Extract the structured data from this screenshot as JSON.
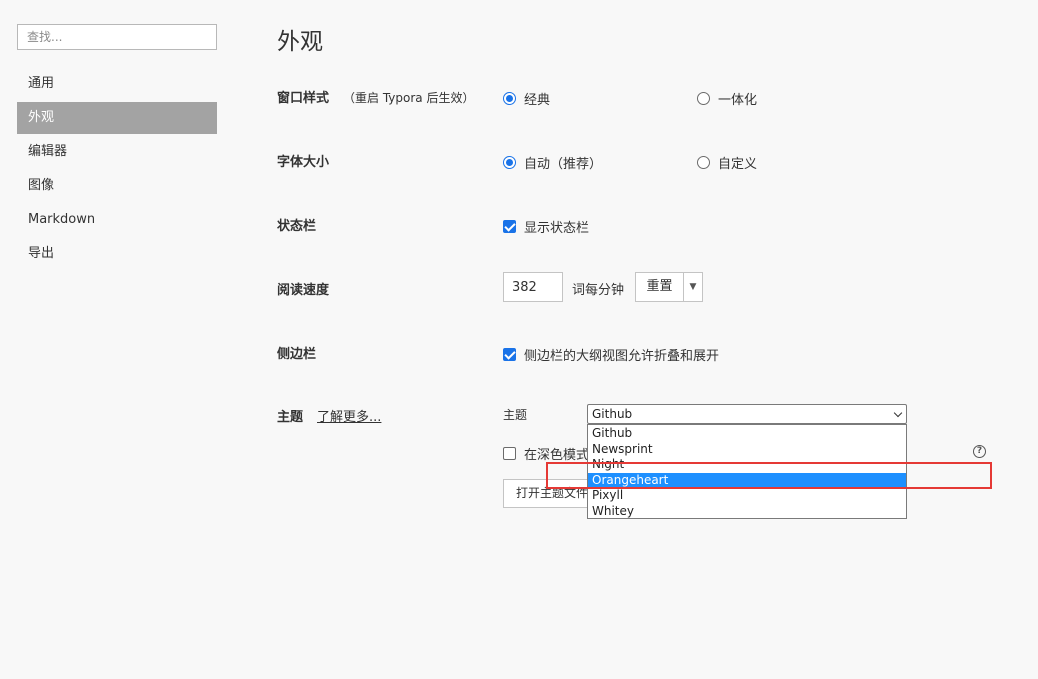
{
  "search": {
    "placeholder": "查找..."
  },
  "sidebar": {
    "items": [
      {
        "label": "通用",
        "active": false
      },
      {
        "label": "外观",
        "active": true
      },
      {
        "label": "编辑器",
        "active": false
      },
      {
        "label": "图像",
        "active": false
      },
      {
        "label": "Markdown",
        "active": false
      },
      {
        "label": "导出",
        "active": false
      }
    ]
  },
  "page": {
    "title": "外观"
  },
  "window_style": {
    "label": "窗口样式",
    "hint": "（重启 Typora 后生效）",
    "options": [
      {
        "label": "经典",
        "selected": true
      },
      {
        "label": "一体化",
        "selected": false
      }
    ]
  },
  "font_size": {
    "label": "字体大小",
    "options": [
      {
        "label": "自动（推荐）",
        "selected": true
      },
      {
        "label": "自定义",
        "selected": false
      }
    ]
  },
  "status_bar": {
    "label": "状态栏",
    "checkbox_label": "显示状态栏",
    "checked": true
  },
  "reading_speed": {
    "label": "阅读速度",
    "value": "382",
    "unit": "词每分钟",
    "reset_label": "重置",
    "caret": "▼"
  },
  "sidebar_section": {
    "label": "侧边栏",
    "checkbox_label": "侧边栏的大纲视图允许折叠和展开",
    "checked": true
  },
  "theme": {
    "label": "主题",
    "learn_more": "了解更多...",
    "sub_label": "主题",
    "selected": "Github",
    "options": [
      "Github",
      "Newsprint",
      "Night",
      "Orangeheart",
      "Pixyll",
      "Whitey"
    ],
    "highlighted_option": "Orangeheart",
    "dark_mode_label": "在深色模式",
    "dark_mode_checked": false,
    "open_folder_label": "打开主题文件夹",
    "help_glyph": "?"
  },
  "colors": {
    "accent": "#1a73e8",
    "highlight": "#1e90ff",
    "annotation": "#e53935",
    "nav_active": "#a3a3a3"
  }
}
